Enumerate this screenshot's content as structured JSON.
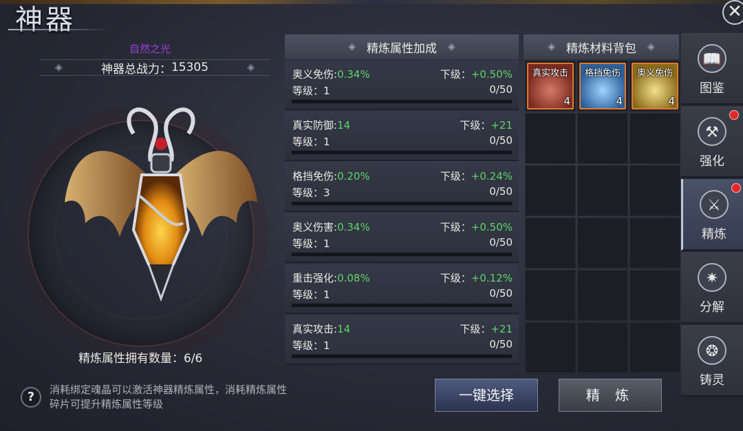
{
  "window": {
    "title": "神器"
  },
  "artifact": {
    "name": "自然之光",
    "power_label": "神器总战力：",
    "power_value": "15305",
    "refine_count_label": "精炼属性拥有数量：",
    "refine_count_value": "6/6"
  },
  "hint": {
    "text": "消耗绑定魂晶可以激活神器精炼属性，消耗精炼属性碎片可提升精炼属性等级"
  },
  "bonus_panel": {
    "title": "精炼属性加成",
    "next_label": "下级：",
    "level_label": "等级：",
    "items": [
      {
        "name": "奥义免伤:",
        "value": "0.34%",
        "next": "+0.50%",
        "level": "1",
        "progress": "0/50",
        "fraction": 0
      },
      {
        "name": "真实防御:",
        "value": "14",
        "next": "+21",
        "level": "1",
        "progress": "0/50",
        "fraction": 0
      },
      {
        "name": "格挡免伤:",
        "value": "0.20%",
        "next": "+0.24%",
        "level": "3",
        "progress": "0/50",
        "fraction": 0
      },
      {
        "name": "奥义伤害:",
        "value": "0.34%",
        "next": "+0.50%",
        "level": "1",
        "progress": "0/50",
        "fraction": 0
      },
      {
        "name": "重击强化:",
        "value": "0.08%",
        "next": "+0.12%",
        "level": "1",
        "progress": "0/50",
        "fraction": 0
      },
      {
        "name": "真实攻击:",
        "value": "14",
        "next": "+21",
        "level": "1",
        "progress": "0/50",
        "fraction": 0
      }
    ]
  },
  "bag_panel": {
    "title": "精炼材料背包",
    "items": [
      {
        "name": "真实攻击",
        "count": "4",
        "color": "red"
      },
      {
        "name": "格挡免伤",
        "count": "4",
        "color": "blue"
      },
      {
        "name": "奥义免伤",
        "count": "4",
        "color": "gold"
      }
    ],
    "empty_slots": 15
  },
  "buttons": {
    "one_click_select": "一键选择",
    "refine": "精 炼"
  },
  "tabs": [
    {
      "label": "图鉴",
      "icon": "book-icon",
      "dot": false,
      "active": false
    },
    {
      "label": "强化",
      "icon": "hammers-icon",
      "dot": true,
      "active": false
    },
    {
      "label": "精炼",
      "icon": "anvil-icon",
      "dot": true,
      "active": true
    },
    {
      "label": "分解",
      "icon": "gear-star-icon",
      "dot": false,
      "active": false
    },
    {
      "label": "铸灵",
      "icon": "spirit-icon",
      "dot": false,
      "active": false
    }
  ],
  "colors": {
    "accent_green": "#5fd46a",
    "name_purple": "#9b3fd8",
    "item_border_orange": "#e07a2a",
    "notification_red": "#e02a2a"
  }
}
